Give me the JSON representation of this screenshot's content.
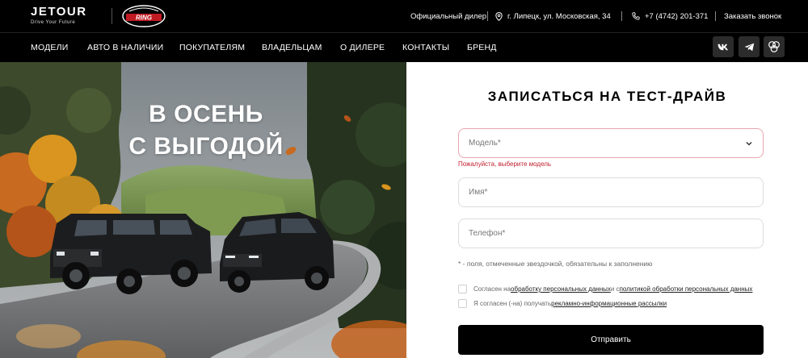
{
  "header": {
    "brand_name": "JETOUR",
    "brand_tagline": "Drive Your Future",
    "dealer_logo_text": "RING",
    "dealer_label": "Официальный дилер",
    "address": "г. Липецк, ул. Московская, 34",
    "phone": "+7 (4742) 201-371",
    "callback_label": "Заказать звонок",
    "icons": [
      "location-pin-icon",
      "phone-icon"
    ]
  },
  "nav": {
    "items": [
      {
        "label": "МОДЕЛИ"
      },
      {
        "label": "АВТО В НАЛИЧИИ"
      },
      {
        "label": "ПОКУПАТЕЛЯМ"
      },
      {
        "label": "ВЛАДЕЛЬЦАМ"
      },
      {
        "label": "О ДИЛЕРЕ"
      },
      {
        "label": "КОНТАКТЫ"
      },
      {
        "label": "БРЕНД"
      }
    ],
    "social": [
      "vk-icon",
      "telegram-icon",
      "odnoklassniki-icon"
    ]
  },
  "hero": {
    "line1": "В ОСЕНЬ",
    "line2": "С ВЫГОДОЙ"
  },
  "form": {
    "title": "ЗАПИСАТЬСЯ НА ТЕСТ-ДРАЙВ",
    "model_placeholder": "Модель*",
    "model_error": "Пожалуйста, выберите модель",
    "name_placeholder": "Имя*",
    "phone_placeholder": "Телефон*",
    "required_note": "* - поля, отмеченные звездочкой, обязательны к заполнению",
    "consent1_prefix": "Согласен на ",
    "consent1_link1": "обработку персональных данных",
    "consent1_middle": " и с ",
    "consent1_link2": "политикой обработки персональных данных",
    "consent2_prefix": "Я согласен (-на) получать ",
    "consent2_link": "рекламно-информационные рассылки",
    "submit_label": "Отправить"
  },
  "colors": {
    "header_bg": "#000000",
    "error": "#c0202f",
    "button_bg": "#000000"
  }
}
